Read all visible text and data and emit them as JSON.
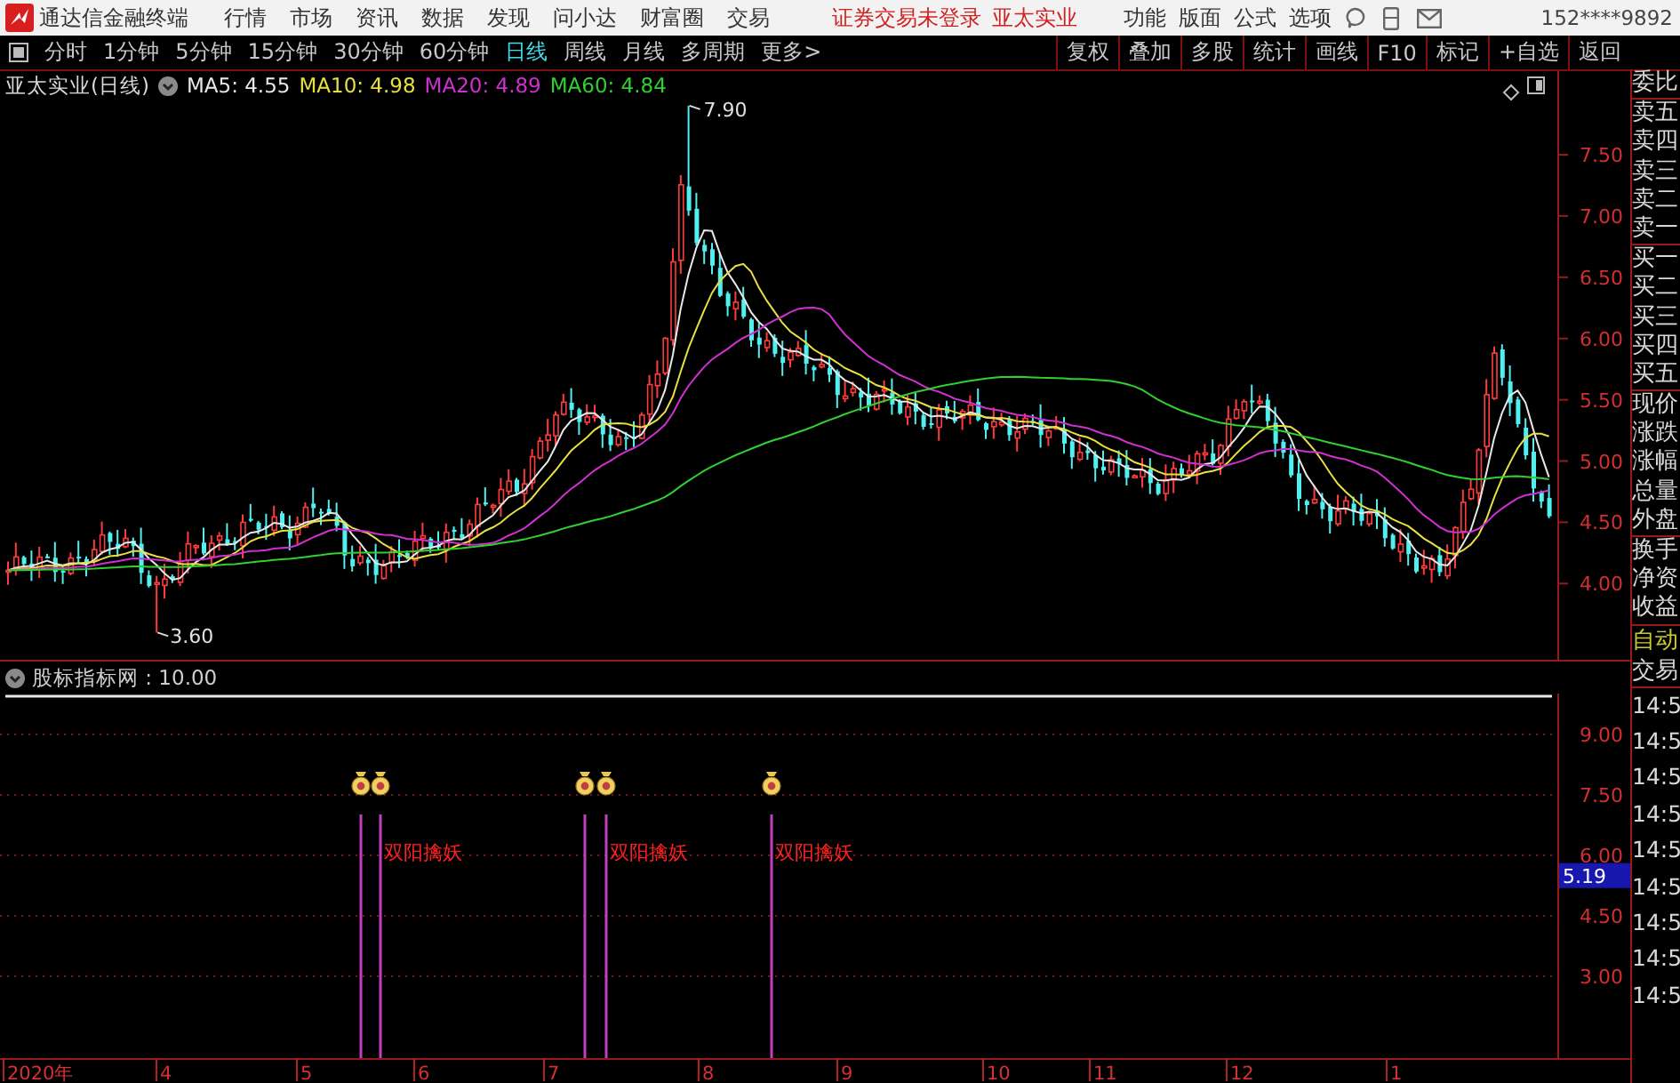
{
  "app": {
    "title": "通达信金融终端",
    "menu": [
      "行情",
      "市场",
      "资讯",
      "数据",
      "发现",
      "问小达",
      "财富圈",
      "交易"
    ],
    "notice": "证券交易未登录",
    "stock_link": "亚太实业",
    "menu_right": [
      "功能",
      "版面",
      "公式",
      "选项"
    ],
    "account": "152****9892"
  },
  "period_tabs": [
    {
      "label": "分时",
      "selected": false
    },
    {
      "label": "1分钟",
      "selected": false
    },
    {
      "label": "5分钟",
      "selected": false
    },
    {
      "label": "15分钟",
      "selected": false
    },
    {
      "label": "30分钟",
      "selected": false
    },
    {
      "label": "60分钟",
      "selected": false
    },
    {
      "label": "日线",
      "selected": true
    },
    {
      "label": "周线",
      "selected": false
    },
    {
      "label": "月线",
      "selected": false
    },
    {
      "label": "多周期",
      "selected": false
    },
    {
      "label": "更多>",
      "selected": false
    }
  ],
  "tools": [
    "复权",
    "叠加",
    "多股",
    "统计",
    "画线",
    "F10",
    "标记",
    "+自选",
    "返回"
  ],
  "chart": {
    "title": "亚太实业(日线)",
    "ma": [
      {
        "label": "MA5: 4.55",
        "color": "#e8e8e8"
      },
      {
        "label": "MA10: 4.98",
        "color": "#e8e040"
      },
      {
        "label": "MA20: 4.89",
        "color": "#d030d0"
      },
      {
        "label": "MA60: 4.84",
        "color": "#30d030"
      }
    ],
    "high_label": "7.90",
    "low_label": "3.60",
    "price_ticks": [
      "7.50",
      "7.00",
      "6.50",
      "6.00",
      "5.50",
      "5.00",
      "4.50",
      "4.00"
    ]
  },
  "indicator": {
    "title": "股标指标网 : 10.00",
    "ticks": [
      "9.00",
      "7.50",
      "6.00",
      "4.50",
      "3.00"
    ],
    "current_value": "5.19",
    "signals": [
      {
        "label": "双阳擒妖"
      },
      {
        "label": "双阳擒妖"
      },
      {
        "label": "双阳擒妖"
      }
    ]
  },
  "x_axis": [
    "2020年",
    "4",
    "5",
    "6",
    "7",
    "8",
    "9",
    "10",
    "11",
    "12",
    "1"
  ],
  "quote_panel": {
    "groups": [
      [
        "委比"
      ],
      [
        "卖五",
        "卖四",
        "卖三",
        "卖二",
        "卖一"
      ],
      [
        "买一",
        "买二",
        "买三",
        "买四",
        "买五"
      ],
      [
        "现价",
        "涨跌",
        "涨幅",
        "总量",
        "外盘"
      ],
      [
        "换手",
        "净资",
        "收益"
      ]
    ],
    "auto": "自动",
    "trade": "交易",
    "times": [
      "14:5",
      "14:5",
      "14:5",
      "14:5",
      "14:5",
      "14:5",
      "14:5",
      "14:5",
      "14:5"
    ]
  }
}
